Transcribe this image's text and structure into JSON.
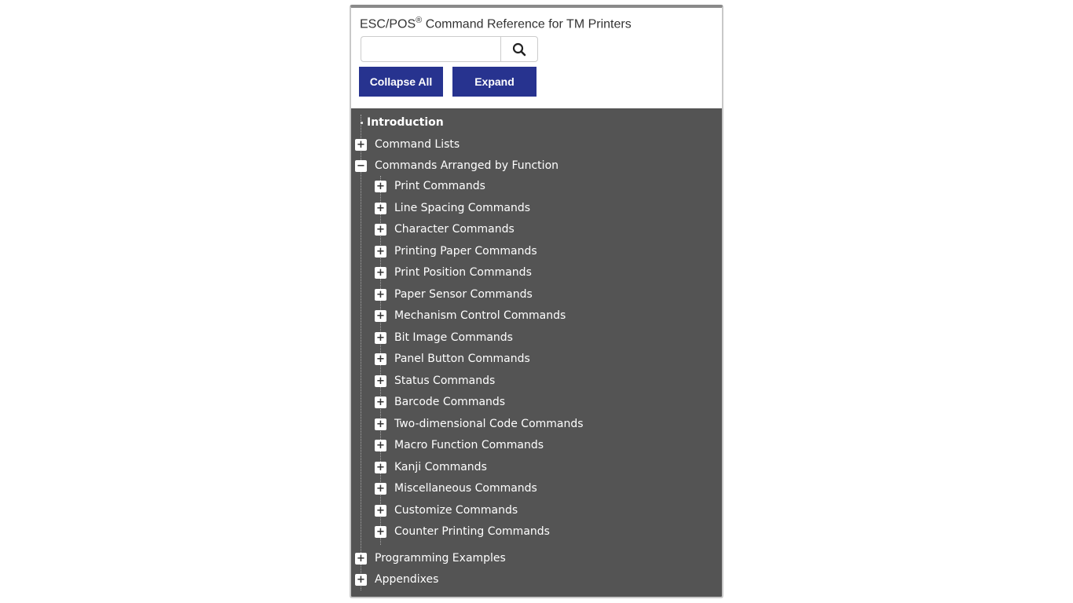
{
  "header": {
    "title": "ESC/POS",
    "title_mark": "®",
    "title_rest": " Command Reference for TM Printers"
  },
  "search": {
    "value": "",
    "placeholder": "",
    "icon": "search-icon"
  },
  "buttons": {
    "collapse_all": "Collapse All",
    "expand": "Expand"
  },
  "colors": {
    "button_bg": "#27338f",
    "tree_bg": "#545454",
    "tree_text": "#ffffff"
  },
  "tree": {
    "introduction": "Introduction",
    "command_lists": "Command Lists",
    "commands_by_function": "Commands Arranged by Function",
    "function_items": [
      "Print Commands",
      "Line Spacing Commands",
      "Character Commands",
      "Printing Paper Commands",
      "Print Position Commands",
      "Paper Sensor Commands",
      "Mechanism Control Commands",
      "Bit Image Commands",
      "Panel Button Commands",
      "Status Commands",
      "Barcode Commands",
      "Two-dimensional Code Commands",
      "Macro Function Commands",
      "Kanji Commands",
      "Miscellaneous Commands",
      "Customize Commands",
      "Counter Printing Commands"
    ],
    "programming_examples": "Programming Examples",
    "appendixes": "Appendixes",
    "expand_symbol": "+",
    "collapse_symbol": "−"
  }
}
